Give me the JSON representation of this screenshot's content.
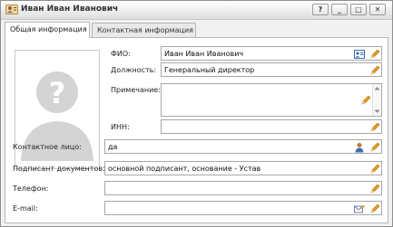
{
  "window": {
    "title": "Иван Иван Иванович",
    "help_label": "?",
    "minimize_label": "_",
    "maximize_label": "□",
    "close_label": "✕"
  },
  "tabs": [
    {
      "label": "Общая информация",
      "active": true
    },
    {
      "label": "Контактная информация",
      "active": false
    }
  ],
  "form": {
    "fio": {
      "label": "ФИО:",
      "value": "Иван Иван Иванович"
    },
    "position": {
      "label": "Должность:",
      "value": "Генеральный директор"
    },
    "note": {
      "label": "Примечание:",
      "value": ""
    },
    "inn": {
      "label": "ИНН:",
      "value": ""
    },
    "contact": {
      "label": "Контактное лицо:",
      "value": "да"
    },
    "signer": {
      "label": "Подписант документов:",
      "value": "основной подписант, основание - Устав"
    },
    "phone": {
      "label": "Телефон:",
      "value": ""
    },
    "email": {
      "label": "E-mail:",
      "value": ""
    }
  },
  "icons": {
    "window": "person-card-icon",
    "photo": "person-placeholder-icon",
    "edit": "pencil-icon",
    "card": "id-card-icon",
    "person": "person-icon",
    "mail": "mail-edit-icon"
  },
  "colors": {
    "pencil": "#e8a21a",
    "card": "#3a6db5",
    "placeholder": "#d4d4d4"
  }
}
